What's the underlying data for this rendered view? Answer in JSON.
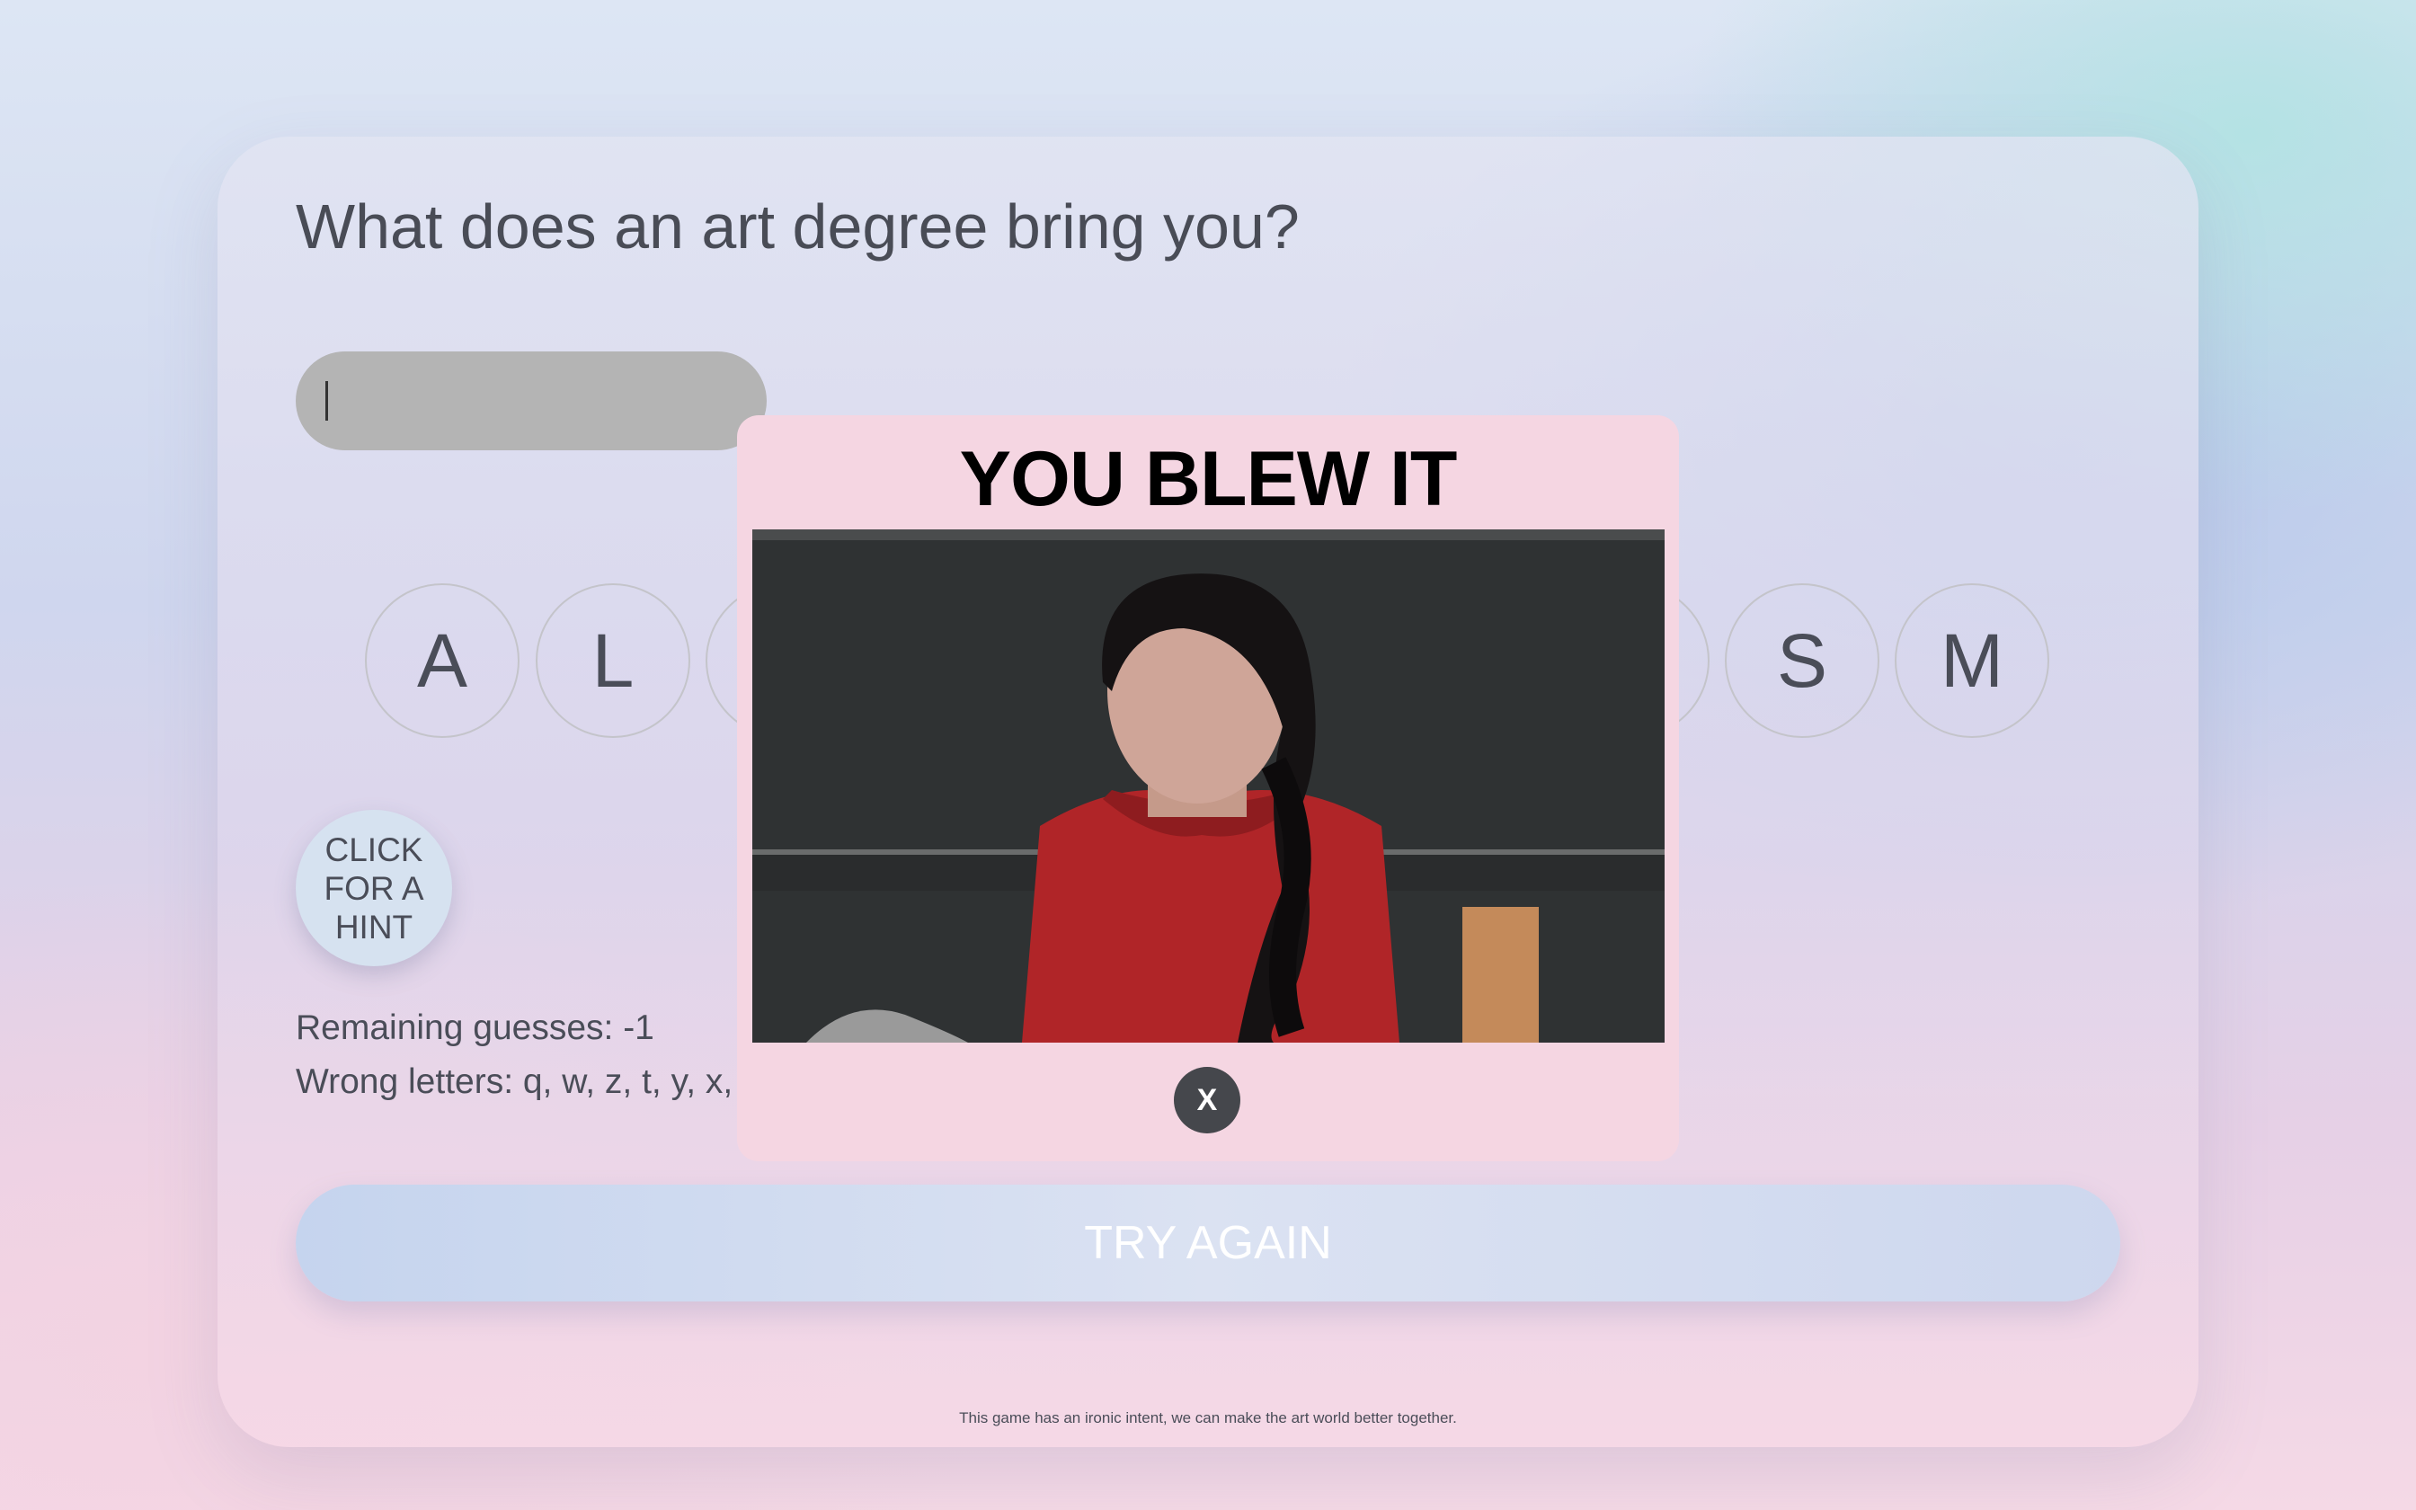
{
  "question": "What does an art degree bring you?",
  "guess_input": {
    "value": ""
  },
  "letter_tiles": [
    {
      "letter": "A"
    },
    {
      "letter": "L"
    },
    {
      "letter": ""
    },
    {
      "letter": ""
    },
    {
      "letter": "S"
    },
    {
      "letter": "M"
    }
  ],
  "hint_button": {
    "label": "CLICK FOR A HINT"
  },
  "status": {
    "remaining_guesses": "Remaining guesses: -1",
    "wrong_letters": "Wrong letters: q, w, z, t, y, x, j,"
  },
  "try_again_button": {
    "label": "TRY AGAIN"
  },
  "footer": "This game has an ironic intent, we can make the art world better together.",
  "modal": {
    "title": "YOU BLEW IT",
    "close_label": "X"
  },
  "colors": {
    "modal_bg": "#f5d6e2",
    "input_bg": "#b4b4b4",
    "close_bg": "#45474c",
    "sweater_red": "#b02528"
  }
}
